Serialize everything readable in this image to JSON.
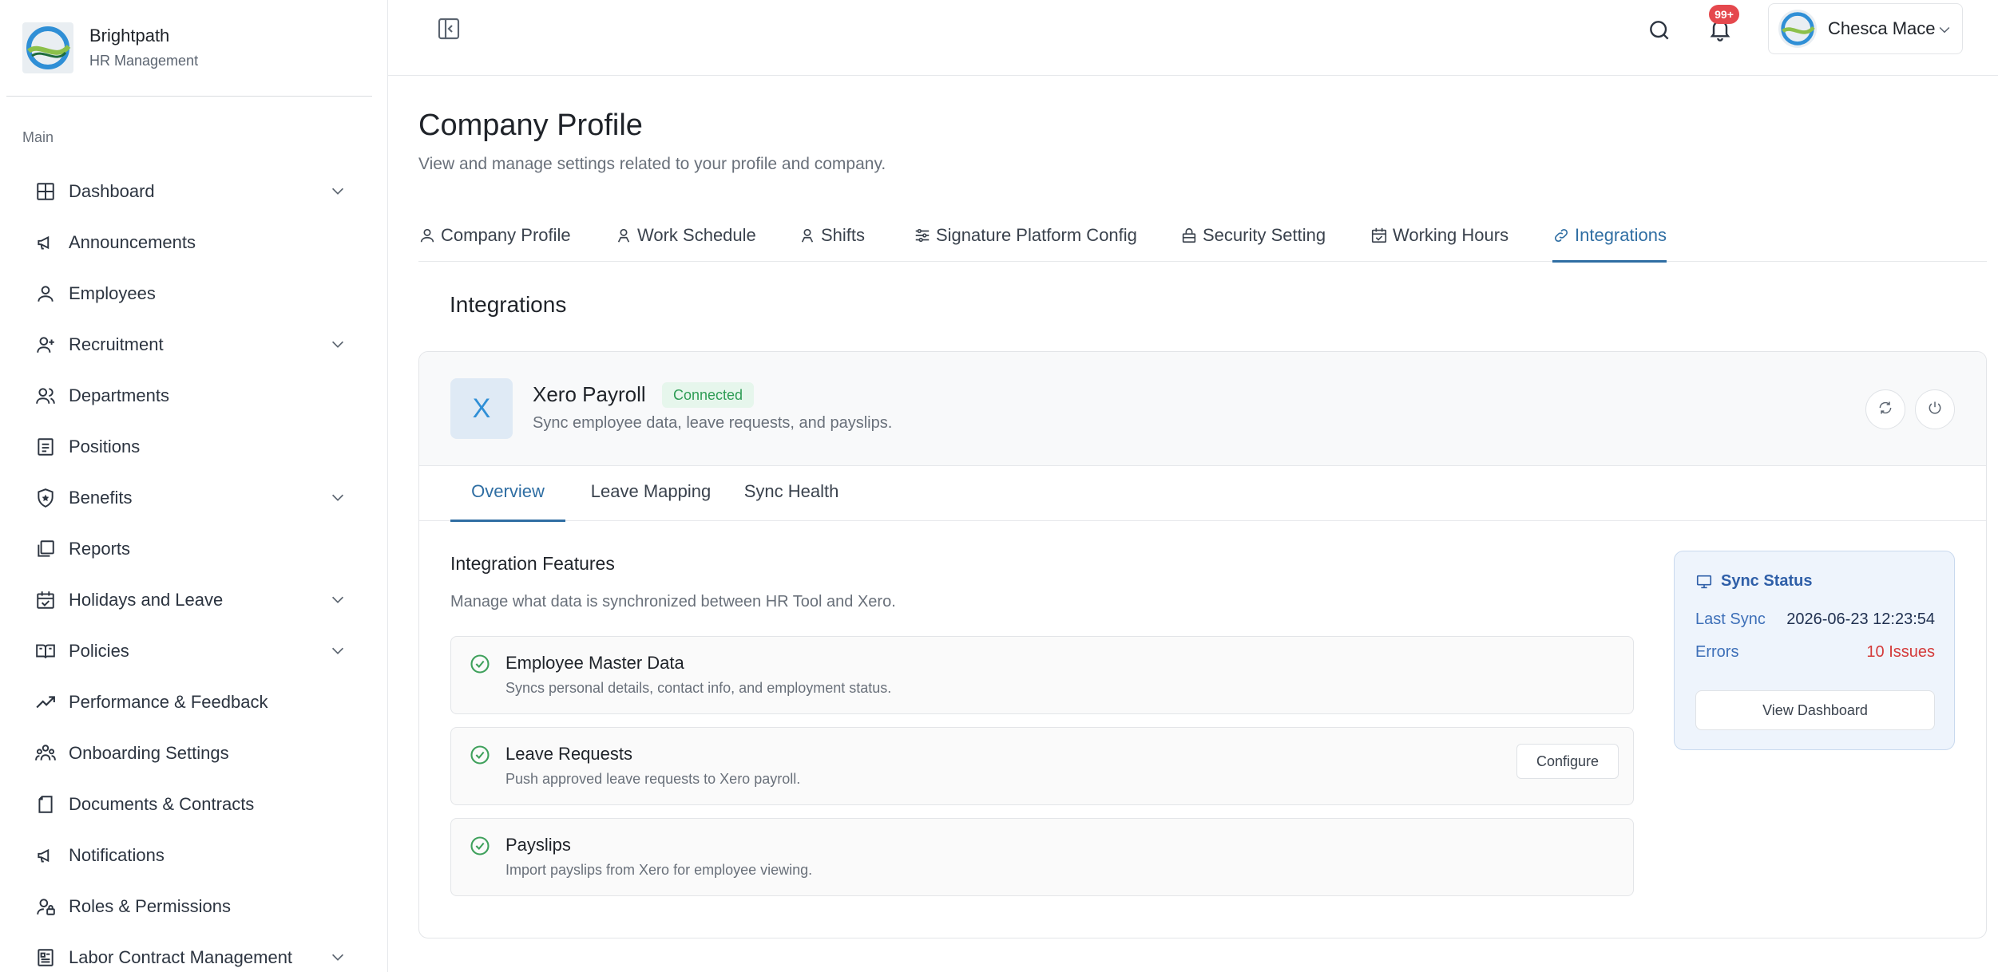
{
  "brand": {
    "name": "Brightpath",
    "subtitle": "HR Management"
  },
  "sidebar": {
    "section_label": "Main",
    "items": [
      {
        "label": "Dashboard",
        "icon": "grid-icon",
        "expandable": true
      },
      {
        "label": "Announcements",
        "icon": "megaphone-icon",
        "expandable": false
      },
      {
        "label": "Employees",
        "icon": "user-icon",
        "expandable": false
      },
      {
        "label": "Recruitment",
        "icon": "user-plus-icon",
        "expandable": true
      },
      {
        "label": "Departments",
        "icon": "users-icon",
        "expandable": false
      },
      {
        "label": "Positions",
        "icon": "clipboard-icon",
        "expandable": false
      },
      {
        "label": "Benefits",
        "icon": "shield-icon",
        "expandable": true
      },
      {
        "label": "Reports",
        "icon": "stack-icon",
        "expandable": false
      },
      {
        "label": "Holidays and Leave",
        "icon": "calendar-icon",
        "expandable": true
      },
      {
        "label": "Policies",
        "icon": "book-icon",
        "expandable": true
      },
      {
        "label": "Performance & Feedback",
        "icon": "trend-icon",
        "expandable": false
      },
      {
        "label": "Onboarding Settings",
        "icon": "people-icon",
        "expandable": false
      },
      {
        "label": "Documents & Contracts",
        "icon": "document-icon",
        "expandable": false
      },
      {
        "label": "Notifications",
        "icon": "megaphone-icon",
        "expandable": false
      },
      {
        "label": "Roles & Permissions",
        "icon": "user-lock-icon",
        "expandable": false
      },
      {
        "label": "Labor Contract Management",
        "icon": "contract-icon",
        "expandable": true
      }
    ]
  },
  "header": {
    "notification_badge": "99+",
    "user_name": "Chesca Mace"
  },
  "page": {
    "title": "Company Profile",
    "subtitle": "View and manage settings related to your profile and company.",
    "tabs": [
      {
        "label": "Company Profile",
        "icon": "user-icon"
      },
      {
        "label": "Work Schedule",
        "icon": "user-icon"
      },
      {
        "label": "Shifts",
        "icon": "user-icon"
      },
      {
        "label": "Signature Platform Config",
        "icon": "sliders-icon"
      },
      {
        "label": "Security Setting",
        "icon": "lock-icon"
      },
      {
        "label": "Working Hours",
        "icon": "calendar-check-icon"
      },
      {
        "label": "Integrations",
        "icon": "link-icon"
      }
    ],
    "active_tab": "Integrations",
    "section_title": "Integrations"
  },
  "integration": {
    "logo_letter": "X",
    "name": "Xero Payroll",
    "status": "Connected",
    "description": "Sync employee data, leave requests, and payslips.",
    "tabs": [
      "Overview",
      "Leave Mapping",
      "Sync Health"
    ],
    "active_tab": "Overview",
    "features_title": "Integration Features",
    "features_subtitle": "Manage what data is synchronized between HR Tool and Xero.",
    "features": [
      {
        "name": "Employee Master Data",
        "description": "Syncs personal details, contact info, and employment status.",
        "action": ""
      },
      {
        "name": "Leave Requests",
        "description": "Push approved leave requests to Xero payroll.",
        "action": "Configure"
      },
      {
        "name": "Payslips",
        "description": "Import payslips from Xero for employee viewing.",
        "action": ""
      }
    ],
    "sync_status": {
      "title": "Sync Status",
      "last_sync_label": "Last Sync",
      "last_sync_value": "2026-06-23 12:23:54",
      "errors_label": "Errors",
      "errors_value": "10 Issues",
      "button": "View Dashboard"
    }
  },
  "colors": {
    "accent": "#2f6ea3",
    "connected": "#2e9c55",
    "error": "#d43b3b",
    "badge": "#e5484d"
  }
}
